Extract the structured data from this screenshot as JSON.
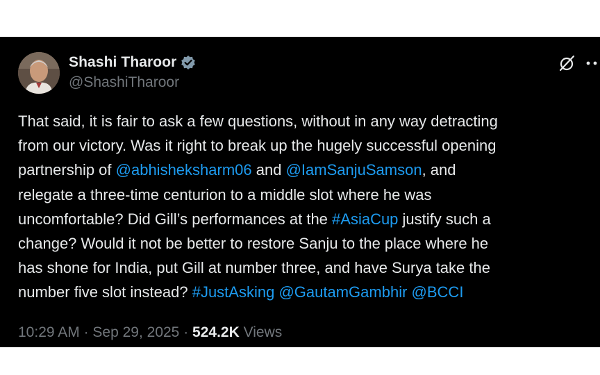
{
  "author": {
    "name": "Shashi Tharoor",
    "handle": "@ShashiTharoor",
    "verified_icon": "verified-badge-icon"
  },
  "tweet": {
    "lines": [
      [
        {
          "text": "That said, it is fair to ask a few questions, without in any way detracting"
        }
      ],
      [
        {
          "text": "from our victory. Was it right to break up the hugely successful opening"
        }
      ],
      [
        {
          "text": "partnership of "
        },
        {
          "text": "@abhisheksharm06",
          "link": true
        },
        {
          "text": " and "
        },
        {
          "text": "@IamSanjuSamson",
          "link": true
        },
        {
          "text": ", and"
        }
      ],
      [
        {
          "text": "relegate a three-time centurion to a middle slot where he was"
        }
      ],
      [
        {
          "text": "uncomfortable? Did Gill’s performances at the "
        },
        {
          "text": "#AsiaCup",
          "link": true
        },
        {
          "text": " justify such a"
        }
      ],
      [
        {
          "text": "change? Would it not be better to restore Sanju to the place where he"
        }
      ],
      [
        {
          "text": "has shone for India, put Gill at number three, and have Surya take the"
        }
      ],
      [
        {
          "text": "number five slot instead? "
        },
        {
          "text": "#JustAsking",
          "link": true
        },
        {
          "text": " "
        },
        {
          "text": "@GautamGambhir",
          "link": true
        },
        {
          "text": " "
        },
        {
          "text": "@BCCI",
          "link": true
        }
      ]
    ]
  },
  "meta": {
    "time": "10:29 AM",
    "separator": " · ",
    "date": "Sep 29, 2025",
    "views_count": "524.2K",
    "views_label": "Views"
  },
  "icons": {
    "grok": "grok-icon",
    "more": "more-options-icon"
  },
  "colors": {
    "background": "#000000",
    "text": "#e7e9ea",
    "secondary": "#71767b",
    "link": "#1d9bf0",
    "verified": "#829aab"
  }
}
